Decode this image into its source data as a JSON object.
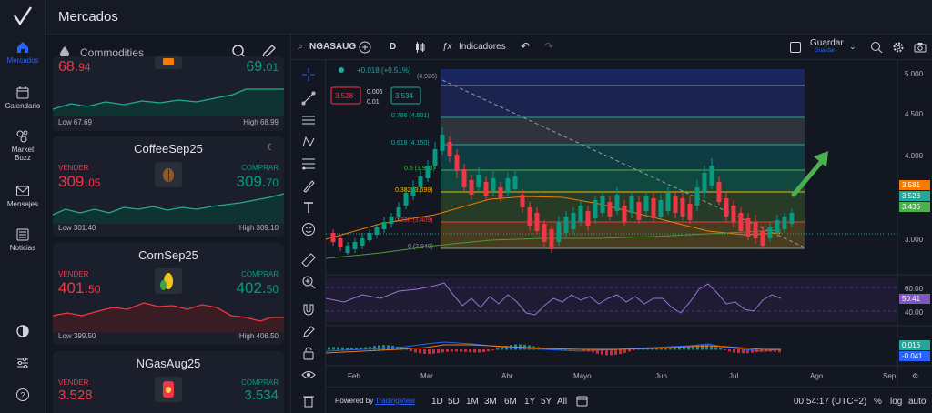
{
  "app": {
    "title": "Mercados"
  },
  "rail": {
    "items": [
      {
        "label": "Mercados",
        "icon": "home-icon",
        "active": true
      },
      {
        "label": "Calendario",
        "icon": "calendar-icon",
        "active": false
      },
      {
        "label": "Market Buzz",
        "icon": "buzz-icon",
        "active": false
      },
      {
        "label": "Mensajes",
        "icon": "mail-icon",
        "active": false
      },
      {
        "label": "Noticias",
        "icon": "news-icon",
        "active": false
      }
    ]
  },
  "watchlist": {
    "category": "Commodities",
    "cards": [
      {
        "name": "",
        "sell_int": "68.",
        "sell_dec": "94",
        "buy_int": "69.",
        "buy_dec": "01",
        "low": "Low 67.69",
        "high": "High 68.99",
        "trend": "up",
        "icon": "oil-icon"
      },
      {
        "name": "CoffeeSep25",
        "sell_label": "VENDER",
        "buy_label": "COMPRAR",
        "sell_int": "309.",
        "sell_dec": "05",
        "buy_int": "309.",
        "buy_dec": "70",
        "low": "Low 301.40",
        "high": "High 309.10",
        "trend": "up",
        "icon": "coffee-icon"
      },
      {
        "name": "CornSep25",
        "sell_label": "VENDER",
        "buy_label": "COMPRAR",
        "sell_int": "401.",
        "sell_dec": "50",
        "buy_int": "402.",
        "buy_dec": "50",
        "low": "Low 399.50",
        "high": "High 406.50",
        "trend": "down",
        "icon": "corn-icon"
      },
      {
        "name": "NGasAug25",
        "sell_label": "VENDER",
        "buy_label": "COMPRAR",
        "sell_int": "3.528",
        "sell_dec": "",
        "buy_int": "3.534",
        "buy_dec": "",
        "low": "",
        "high": "",
        "trend": "none",
        "icon": "gas-icon"
      }
    ]
  },
  "chart": {
    "symbol": "NGASAUG",
    "interval": "D",
    "indicators_label": "Indicadores",
    "save_label": "Guardar",
    "save_sub": "Guardar",
    "change": "+0.018 (+0.51%)",
    "sell_box": "3.528",
    "spread_top": "0.006",
    "spread_bottom": "0.01",
    "buy_box": "3.534",
    "powered": "Powered by",
    "powered_link": "TradingView",
    "ranges": [
      "1D",
      "5D",
      "1M",
      "3M",
      "6M",
      "1Y",
      "5Y",
      "All"
    ],
    "clock": "00:54:17 (UTC+2)",
    "pct": "%",
    "log": "log",
    "auto": "auto",
    "y_ticks": [
      "5.000",
      "4.500",
      "4.000",
      "3.500",
      "3.000"
    ],
    "x_ticks": [
      "Feb",
      "Mar",
      "Abr",
      "Mayo",
      "Jun",
      "Jul",
      "Ago",
      "Sep"
    ],
    "price_labels": {
      "high": "3.581",
      "last": "3.528",
      "low": "3.436"
    },
    "rsi_ticks": [
      "60.00",
      "40.00"
    ],
    "rsi_label": "50.41",
    "macd_labels": {
      "a": "0.016",
      "b": "-0.041"
    },
    "fib_levels": [
      {
        "label": "(4.926)"
      },
      {
        "label": "0.786 (4.501)"
      },
      {
        "label": "0.618 (4.150)"
      },
      {
        "label": "0.5 (3.933)"
      },
      {
        "label": "0.382 (3.699)"
      },
      {
        "label": "0.236 (3.409)"
      },
      {
        "label": "0 (2.940)"
      }
    ],
    "colors": {
      "up": "#089981",
      "down": "#f23645",
      "accent": "#2962ff",
      "orange": "#f57c00",
      "ma_green": "#4c9a3b"
    }
  }
}
